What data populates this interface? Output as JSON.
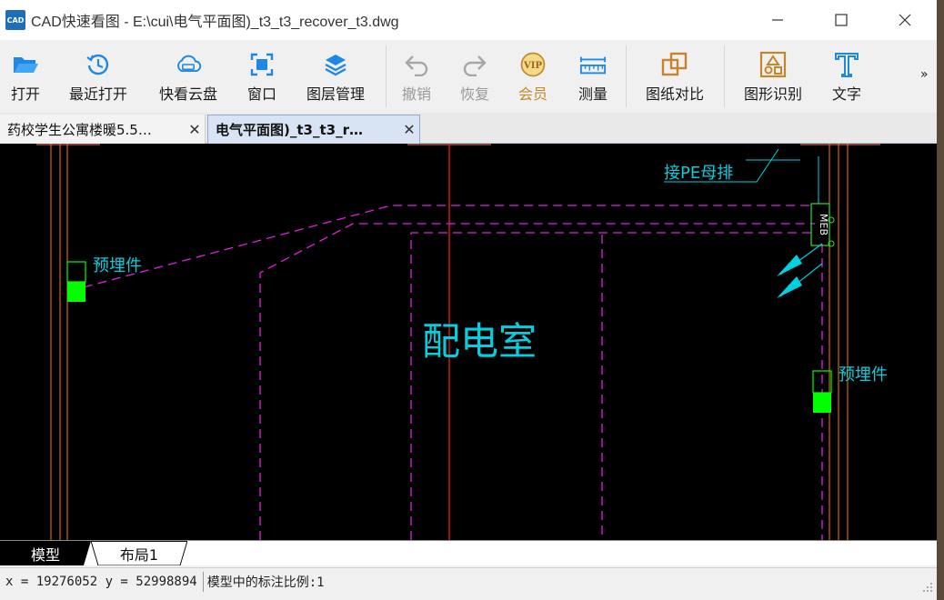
{
  "window": {
    "title": "CAD快速看图 - E:\\cui\\电气平面图)_t3_t3_recover_t3.dwg",
    "app_icon_text": "CAD"
  },
  "toolbar": {
    "items": [
      {
        "label": "打开",
        "icon": "folder-open-icon"
      },
      {
        "label": "最近打开",
        "icon": "history-icon"
      },
      {
        "label": "快看云盘",
        "icon": "cloud-drive-icon"
      },
      {
        "label": "窗口",
        "icon": "window-icon"
      },
      {
        "label": "图层管理",
        "icon": "layers-icon"
      },
      {
        "label": "撤销",
        "icon": "undo-icon",
        "disabled": true
      },
      {
        "label": "恢复",
        "icon": "redo-icon",
        "disabled": true
      },
      {
        "label": "会员",
        "icon": "vip-icon",
        "badge": "VIP"
      },
      {
        "label": "测量",
        "icon": "ruler-icon"
      },
      {
        "label": "图纸对比",
        "icon": "compare-icon"
      },
      {
        "label": "图形识别",
        "icon": "shape-recognize-icon"
      },
      {
        "label": "文字",
        "icon": "text-icon"
      }
    ],
    "more": "»"
  },
  "tabs": [
    {
      "label": "药校学生公寓楼暖5.5…",
      "active": false
    },
    {
      "label": "电气平面图)_t3_t3_r…",
      "active": true
    }
  ],
  "drawing": {
    "labels": {
      "pe_bar": "接PE母排",
      "embed_left": "预埋件",
      "embed_right": "预埋件",
      "room": "配电室",
      "meb": "MEB"
    },
    "colors": {
      "wall": "#ff7a00",
      "dashed": "#e020e0",
      "text": "#00d0e0",
      "embed": "#00ff00",
      "center": "#ff2020",
      "background": "#000000"
    }
  },
  "layouts": [
    {
      "label": "模型",
      "active": true
    },
    {
      "label": "布局1",
      "active": false
    }
  ],
  "status": {
    "coords": "x = 19276052 y = 52998894",
    "message": "模型中的标注比例:1"
  }
}
